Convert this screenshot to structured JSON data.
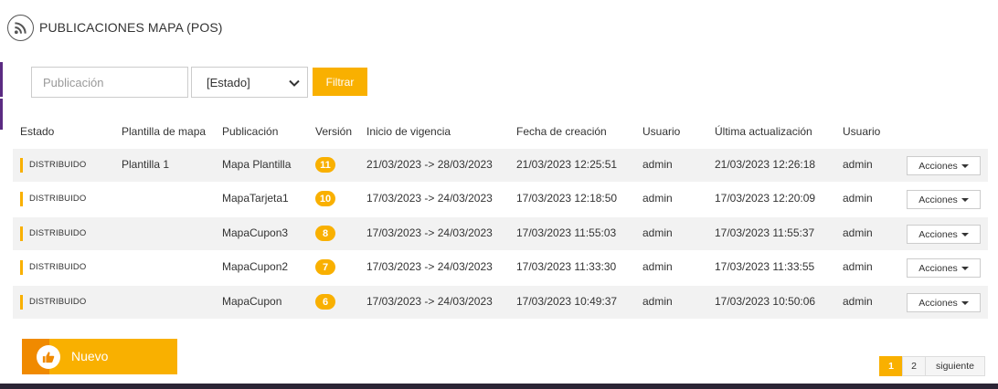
{
  "header": {
    "title": "PUBLICACIONES MAPA (POS)",
    "icon": "rss-icon"
  },
  "filters": {
    "publication_placeholder": "Publicación",
    "status_selected": "[Estado]",
    "filter_label": "Filtrar"
  },
  "table": {
    "columns": [
      "Estado",
      "Plantilla de mapa",
      "Publicación",
      "Versión",
      "Inicio de vigencia",
      "Fecha de creación",
      "Usuario",
      "Última actualización",
      "Usuario"
    ],
    "rows": [
      {
        "status": "DISTRIBUIDO",
        "template": "Plantilla 1",
        "publication": "Mapa Plantilla",
        "version": "11",
        "validity": "21/03/2023 -> 28/03/2023",
        "created": "21/03/2023 12:25:51",
        "user": "admin",
        "updated": "21/03/2023 12:26:18",
        "updated_user": "admin",
        "actions": "Acciones"
      },
      {
        "status": "DISTRIBUIDO",
        "template": "",
        "publication": "MapaTarjeta1",
        "version": "10",
        "validity": "17/03/2023 -> 24/03/2023",
        "created": "17/03/2023 12:18:50",
        "user": "admin",
        "updated": "17/03/2023 12:20:09",
        "updated_user": "admin",
        "actions": "Acciones"
      },
      {
        "status": "DISTRIBUIDO",
        "template": "",
        "publication": "MapaCupon3",
        "version": "8",
        "validity": "17/03/2023 -> 24/03/2023",
        "created": "17/03/2023 11:55:03",
        "user": "admin",
        "updated": "17/03/2023 11:55:37",
        "updated_user": "admin",
        "actions": "Acciones"
      },
      {
        "status": "DISTRIBUIDO",
        "template": "",
        "publication": "MapaCupon2",
        "version": "7",
        "validity": "17/03/2023 -> 24/03/2023",
        "created": "17/03/2023 11:33:30",
        "user": "admin",
        "updated": "17/03/2023 11:33:55",
        "updated_user": "admin",
        "actions": "Acciones"
      },
      {
        "status": "DISTRIBUIDO",
        "template": "",
        "publication": "MapaCupon",
        "version": "6",
        "validity": "17/03/2023 -> 24/03/2023",
        "created": "17/03/2023 10:49:37",
        "user": "admin",
        "updated": "17/03/2023 10:50:06",
        "updated_user": "admin",
        "actions": "Acciones"
      }
    ]
  },
  "nuevo": {
    "label": "Nuevo",
    "icon": "thumbs-up-icon"
  },
  "pagination": {
    "pages": [
      "1",
      "2"
    ],
    "current": "1",
    "next_label": "siguiente"
  },
  "colors": {
    "accent": "#f9b000",
    "accent_dark": "#f08a00",
    "sidebar": "#5b2b82",
    "row_alt": "#f2f2f2"
  }
}
